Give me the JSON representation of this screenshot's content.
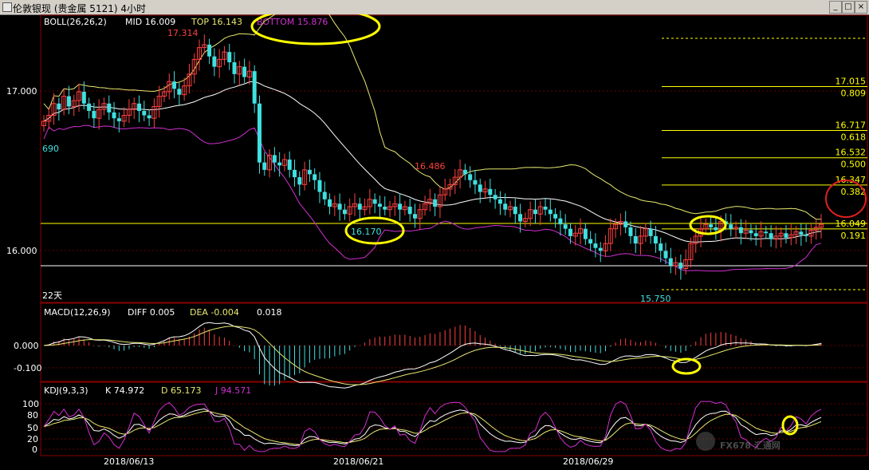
{
  "window": {
    "title": "伦敦银现 (贵金属 5121)  4小时"
  },
  "legend": {
    "boll_label": "BOLL(26,26,2)",
    "mid": "MID 16.009",
    "top": "TOP 16.143",
    "bottom": "BOTTOM 15.876",
    "macd_label": "MACD(12,26,9)",
    "diff": "DIFF 0.005",
    "dea": "DEA -0.004",
    "macd_val": "0.018",
    "kdj_label": "KDJ(9,3,3)",
    "k": "K 74.972",
    "d": "D 65.173",
    "j": "J 94.571"
  },
  "price_axis": [
    "17.000",
    "16.000"
  ],
  "macd_axis": [
    "0.000",
    "-0.100"
  ],
  "kdj_axis": [
    "100",
    "80",
    "50",
    "20",
    "0"
  ],
  "date_labels": [
    "2018/06/13",
    "2018/06/21",
    "2018/06/29"
  ],
  "annotations": {
    "high": "17.314",
    "swing_high": "16.486",
    "low1": "16.170",
    "low2": "15.750",
    "left_value": "690",
    "period": "22天"
  },
  "fib_levels": [
    {
      "price": "17.015",
      "ratio": "0.809"
    },
    {
      "price": "16.717",
      "ratio": "0.618"
    },
    {
      "price": "16.532",
      "ratio": "0.500"
    },
    {
      "price": "16.347",
      "ratio": "0.382"
    },
    {
      "price": "16.049",
      "ratio": "0.191"
    }
  ],
  "watermark": "FX678 汇通网",
  "colors": {
    "up": "#ff4040",
    "down": "#3fe0e0",
    "boll_top": "#e8e870",
    "boll_mid": "#ffffff",
    "boll_bot": "#d030d0",
    "fib": "#ffff00"
  },
  "chart_data": {
    "type": "candlestick",
    "ylim": [
      15.55,
      17.5
    ],
    "start_price": 16.75,
    "closes": [
      16.78,
      16.82,
      16.9,
      16.86,
      16.95,
      16.88,
      16.92,
      16.98,
      16.9,
      16.85,
      16.8,
      16.86,
      16.9,
      16.84,
      16.8,
      16.78,
      16.82,
      16.86,
      16.9,
      16.85,
      16.82,
      16.8,
      16.88,
      16.95,
      16.98,
      17.05,
      17.0,
      16.96,
      17.02,
      17.1,
      17.2,
      17.28,
      17.3,
      17.22,
      17.15,
      17.2,
      17.25,
      17.18,
      17.1,
      17.15,
      17.08,
      17.12,
      16.9,
      16.5,
      16.45,
      16.55,
      16.5,
      16.48,
      16.52,
      16.45,
      16.4,
      16.35,
      16.45,
      16.42,
      16.38,
      16.3,
      16.25,
      16.2,
      16.22,
      16.18,
      16.15,
      16.2,
      16.22,
      16.18,
      16.2,
      16.25,
      16.22,
      16.2,
      16.18,
      16.2,
      16.22,
      16.18,
      16.2,
      16.15,
      16.12,
      16.18,
      16.22,
      16.25,
      16.2,
      16.28,
      16.32,
      16.35,
      16.4,
      16.45,
      16.42,
      16.38,
      16.35,
      16.3,
      16.32,
      16.28,
      16.25,
      16.22,
      16.18,
      16.2,
      16.15,
      16.1,
      16.12,
      16.18,
      16.15,
      16.2,
      16.18,
      16.15,
      16.12,
      16.08,
      16.05,
      16.0,
      16.02,
      16.05,
      15.98,
      15.95,
      15.92,
      15.9,
      15.95,
      16.05,
      16.08,
      16.1,
      16.06,
      16.0,
      15.95,
      16.0,
      16.05,
      16.0,
      15.95,
      15.9,
      15.85,
      15.8,
      15.82,
      15.78,
      15.84,
      15.95,
      16.0,
      16.05,
      16.08,
      16.06,
      16.04,
      16.1,
      16.08,
      16.05,
      16.06,
      16.02,
      16.04,
      16.02,
      16.0,
      16.03,
      16.02,
      15.98,
      16.0,
      16.02,
      15.99,
      16.01,
      16.03,
      16.01,
      16.0,
      16.04,
      16.06,
      16.08
    ],
    "high_marker": 17.314,
    "low_marker": 15.75,
    "x_dates": [
      "2018/06/13",
      "2018/06/21",
      "2018/06/29"
    ]
  }
}
